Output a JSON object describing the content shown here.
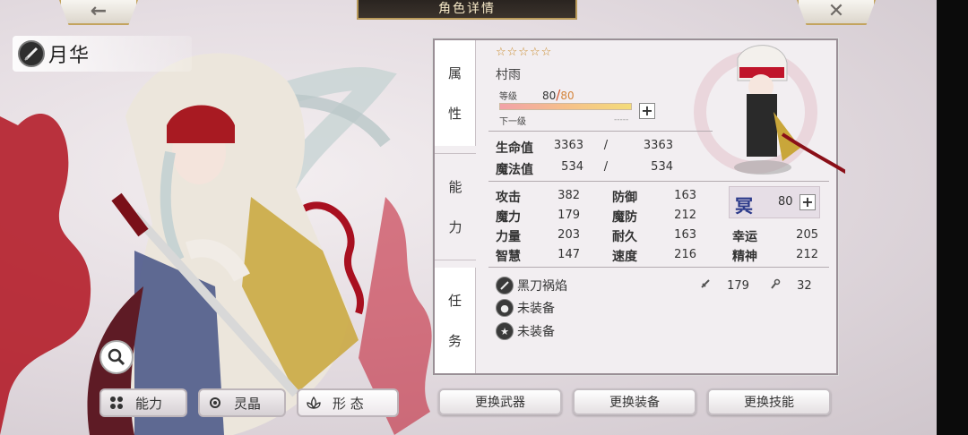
{
  "header": {
    "title": "角色详情",
    "back_icon": "←",
    "close_icon": "✕"
  },
  "character": {
    "name": "月华",
    "name_icon": "blade-emblem-icon"
  },
  "tabs": [
    {
      "label1": "属",
      "label2": "性"
    },
    {
      "label1": "能",
      "label2": "力"
    },
    {
      "label1": "任",
      "label2": "务"
    }
  ],
  "weapon": {
    "stars": "☆☆☆☆☆",
    "name": "村雨",
    "level_label": "等级",
    "level_current": "80",
    "level_sep": "/",
    "level_max": "80",
    "level_fraction": 1.0,
    "next_label": "下一级",
    "next_value": "-----"
  },
  "vitals": {
    "hp_label": "生命值",
    "hp_current": "3363",
    "hp_sep": "/",
    "hp_max": "3363",
    "mp_label": "魔法值",
    "mp_current": "534",
    "mp_sep": "/",
    "mp_max": "534"
  },
  "stats": {
    "atk_label": "攻击",
    "atk": "382",
    "def_label": "防御",
    "def": "163",
    "mag_label": "魔力",
    "mag": "179",
    "mdef_label": "魔防",
    "mdef": "212",
    "str_label": "力量",
    "str": "203",
    "end_label": "耐久",
    "end": "163",
    "luck_label": "幸运",
    "luck": "205",
    "wis_label": "智慧",
    "wis": "147",
    "spd_label": "速度",
    "spd": "216",
    "spirit_label": "精神",
    "spirit": "212"
  },
  "seal": {
    "glyph": "冥",
    "value": "80"
  },
  "equipment": {
    "weapon_name": "黑刀祸焰",
    "weapon_atk": "179",
    "weapon_mag": "32",
    "slot2": "未装备",
    "slot3": "未装备"
  },
  "buttons": {
    "change_weapon": "更换武器",
    "change_equip": "更换装备",
    "change_skill": "更换技能",
    "ability": "能力",
    "crystal": "灵晶",
    "form": "形 态"
  },
  "colors": {
    "accent_gold": "#c3a45e",
    "level_max": "#d4843a",
    "seal": "#2b3a8a"
  }
}
